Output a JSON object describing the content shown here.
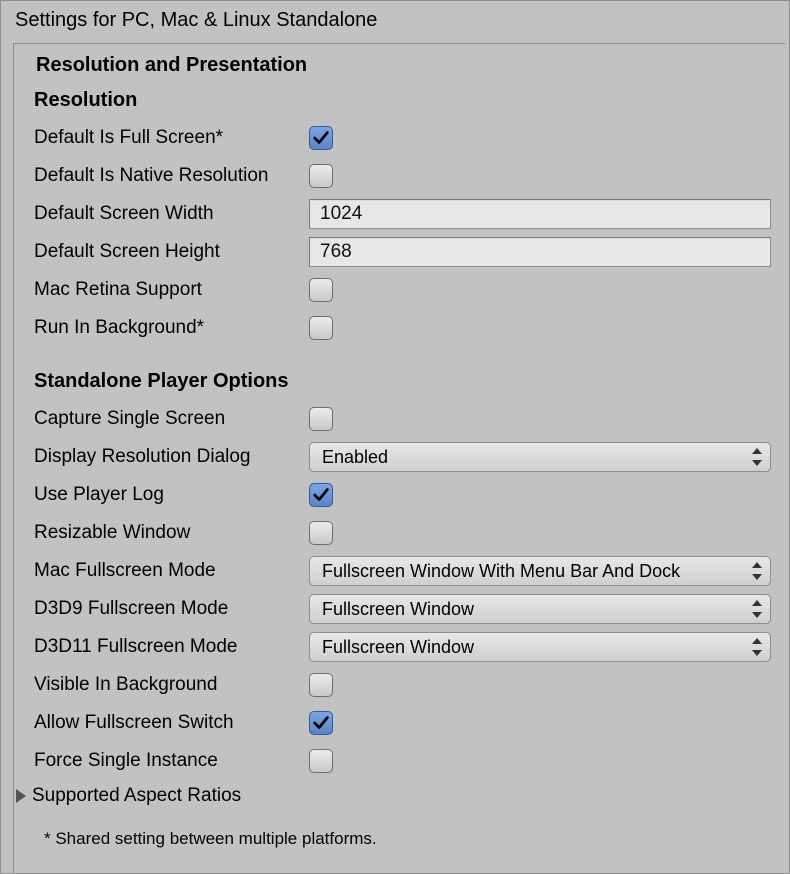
{
  "panelTitle": "Settings for PC, Mac & Linux Standalone",
  "sectionTitle": "Resolution and Presentation",
  "resolution": {
    "title": "Resolution",
    "defaultIsFullScreen": {
      "label": "Default Is Full Screen*",
      "checked": true
    },
    "defaultIsNativeResolution": {
      "label": "Default Is Native Resolution",
      "checked": false
    },
    "defaultScreenWidth": {
      "label": "Default Screen Width",
      "value": "1024"
    },
    "defaultScreenHeight": {
      "label": "Default Screen Height",
      "value": "768"
    },
    "macRetinaSupport": {
      "label": "Mac Retina Support",
      "checked": false
    },
    "runInBackground": {
      "label": "Run In Background*",
      "checked": false
    }
  },
  "standalone": {
    "title": "Standalone Player Options",
    "captureSingleScreen": {
      "label": "Capture Single Screen",
      "checked": false
    },
    "displayResolutionDialog": {
      "label": "Display Resolution Dialog",
      "value": "Enabled"
    },
    "usePlayerLog": {
      "label": "Use Player Log",
      "checked": true
    },
    "resizableWindow": {
      "label": "Resizable Window",
      "checked": false
    },
    "macFullscreenMode": {
      "label": "Mac Fullscreen Mode",
      "value": "Fullscreen Window With Menu Bar And Dock"
    },
    "d3d9FullscreenMode": {
      "label": "D3D9 Fullscreen Mode",
      "value": "Fullscreen Window"
    },
    "d3d11FullscreenMode": {
      "label": "D3D11 Fullscreen Mode",
      "value": "Fullscreen Window"
    },
    "visibleInBackground": {
      "label": "Visible In Background",
      "checked": false
    },
    "allowFullscreenSwitch": {
      "label": "Allow Fullscreen Switch",
      "checked": true
    },
    "forceSingleInstance": {
      "label": "Force Single Instance",
      "checked": false
    },
    "supportedAspectRatios": {
      "label": "Supported Aspect Ratios"
    }
  },
  "footnote": "* Shared setting between multiple platforms."
}
